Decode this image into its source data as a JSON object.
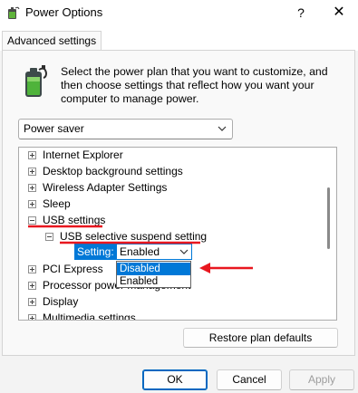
{
  "window": {
    "title": "Power Options",
    "help_glyph": "?",
    "close_glyph": "✕"
  },
  "tabs": [
    {
      "label": "Advanced settings",
      "active": true
    }
  ],
  "description": "Select the power plan that you want to customize, and then choose settings that reflect how you want your computer to manage power.",
  "plan": {
    "selected": "Power saver"
  },
  "tree": {
    "items": [
      {
        "label": "Internet Explorer",
        "expanded": false
      },
      {
        "label": "Desktop background settings",
        "expanded": false
      },
      {
        "label": "Wireless Adapter Settings",
        "expanded": false
      },
      {
        "label": "Sleep",
        "expanded": false
      },
      {
        "label": "USB settings",
        "expanded": true
      },
      {
        "label": "USB selective suspend setting",
        "expanded": true
      },
      {
        "label": "PCI Express",
        "expanded": false
      },
      {
        "label": "Processor power management",
        "expanded": false
      },
      {
        "label": "Display",
        "expanded": false
      },
      {
        "label": "Multimedia settings",
        "expanded": false
      }
    ],
    "setting_label": "Setting:",
    "setting_value": "Enabled",
    "dropdown_options": [
      "Disabled",
      "Enabled"
    ],
    "dropdown_highlighted": "Disabled"
  },
  "buttons": {
    "restore": "Restore plan defaults",
    "ok": "OK",
    "cancel": "Cancel",
    "apply": "Apply"
  },
  "colors": {
    "selection": "#0078d7",
    "annotation": "#e8171f"
  },
  "icons": {
    "app": "power-options-icon",
    "battery": "battery-plug-icon"
  }
}
